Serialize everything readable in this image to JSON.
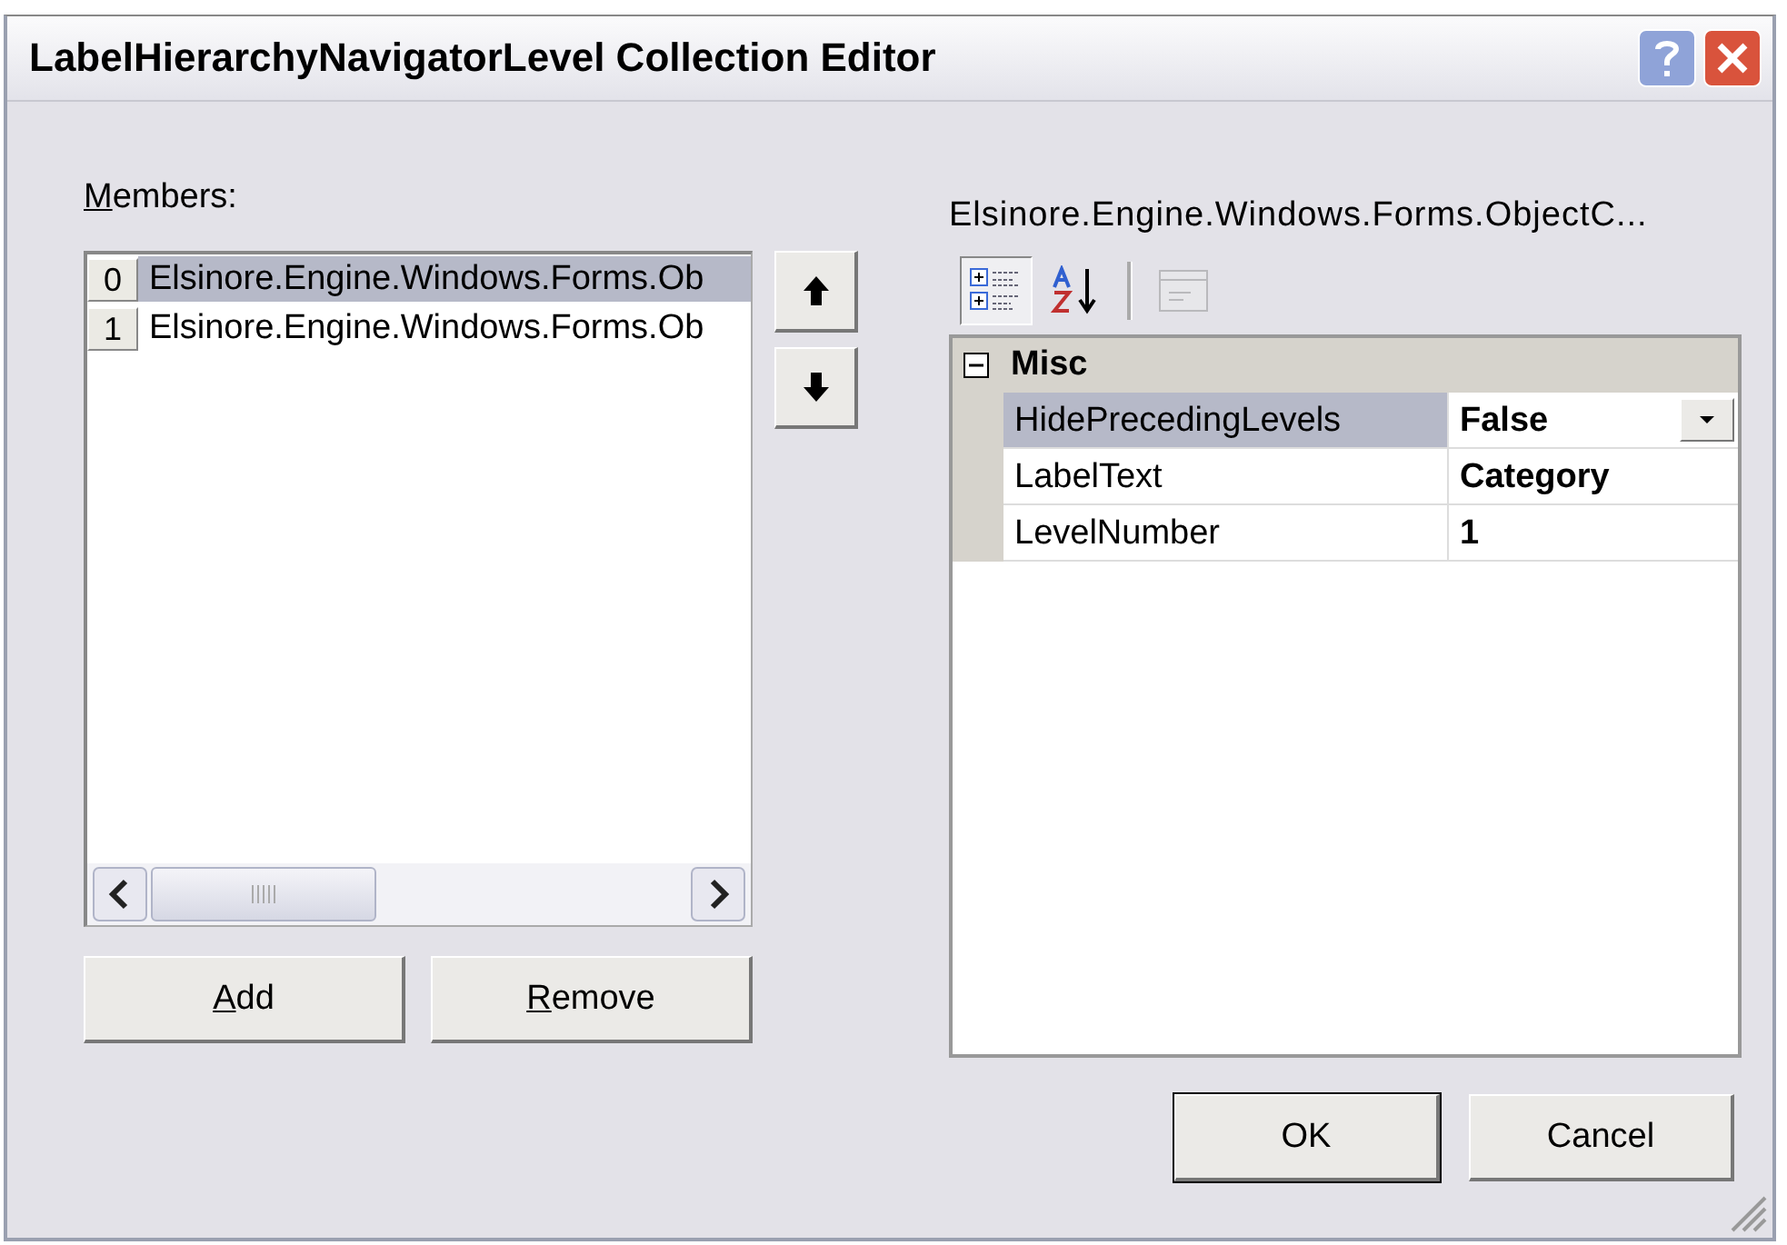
{
  "window": {
    "title": "LabelHierarchyNavigatorLevel Collection Editor"
  },
  "members": {
    "label": "Members:",
    "label_underlined": true,
    "items": [
      {
        "index": "0",
        "text": "Elsinore.Engine.Windows.Forms.Ob",
        "selected": true
      },
      {
        "index": "1",
        "text": "Elsinore.Engine.Windows.Forms.Ob",
        "selected": false
      }
    ]
  },
  "member_buttons": [
    {
      "label": "Add",
      "underlined": true
    },
    {
      "label": "Remove",
      "underlined": true
    }
  ],
  "properties": {
    "title": "Elsinore.Engine.Windows.Forms.ObjectC...",
    "toolbar": [
      {
        "kind": "categorized",
        "selected": true,
        "disabled": false
      },
      {
        "kind": "alphabetical",
        "selected": false,
        "disabled": false
      },
      {
        "kind": "pages",
        "selected": false,
        "disabled": true
      }
    ],
    "category": {
      "name": "Misc",
      "expanded": true
    },
    "rows": [
      {
        "name": "HidePrecedingLevels",
        "value": "False",
        "selected": true
      },
      {
        "name": "LabelText",
        "value": "Category",
        "selected": false
      },
      {
        "name": "LevelNumber",
        "value": "1",
        "selected": false
      }
    ]
  },
  "dialog_buttons": [
    {
      "label": "OK",
      "default": true
    },
    {
      "label": "Cancel",
      "default": false
    }
  ]
}
